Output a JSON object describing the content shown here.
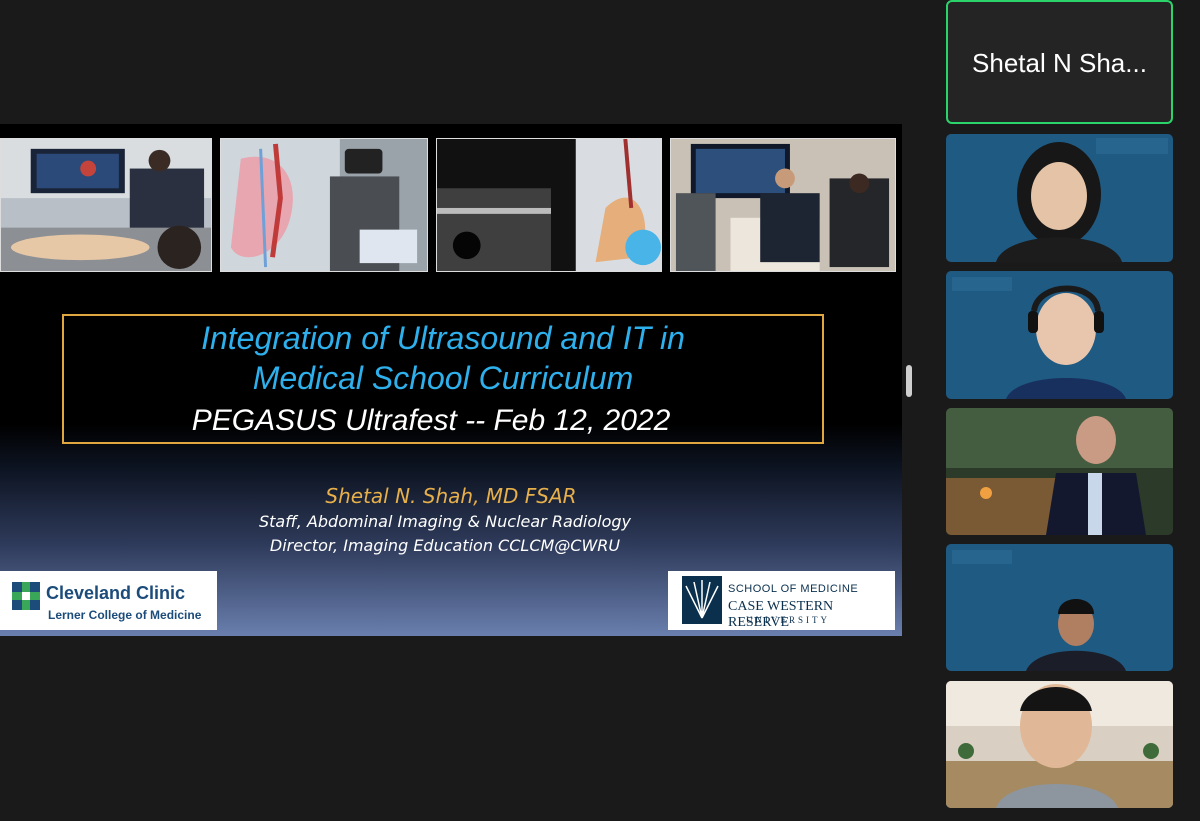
{
  "slide": {
    "title_line1": "Integration of Ultrasound and IT in",
    "title_line2": "Medical School Curriculum",
    "subtitle": "PEGASUS Ultrafest -- Feb 12, 2022",
    "presenter": "Shetal N. Shah, MD FSAR",
    "role1": "Staff, Abdominal Imaging & Nuclear Radiology",
    "role2": "Director, Imaging Education CCLCM@CWRU",
    "logo_left": {
      "name": "Cleveland Clinic",
      "sub": "Lerner College of Medicine"
    },
    "logo_right": {
      "school": "SCHOOL OF MEDICINE",
      "name": "CASE WESTERN RESERVE",
      "univ": "UNIVERSITY"
    }
  },
  "participants": {
    "active_speaker": "Shetal N Sha..."
  },
  "colors": {
    "title_blue": "#2eb0ec",
    "box_gold": "#e0a640",
    "presenter_gold": "#e8b04a",
    "active_border": "#2bd46b",
    "bg": "#1a1a1a"
  },
  "icons": {
    "divider_handle": "drag-handle"
  }
}
